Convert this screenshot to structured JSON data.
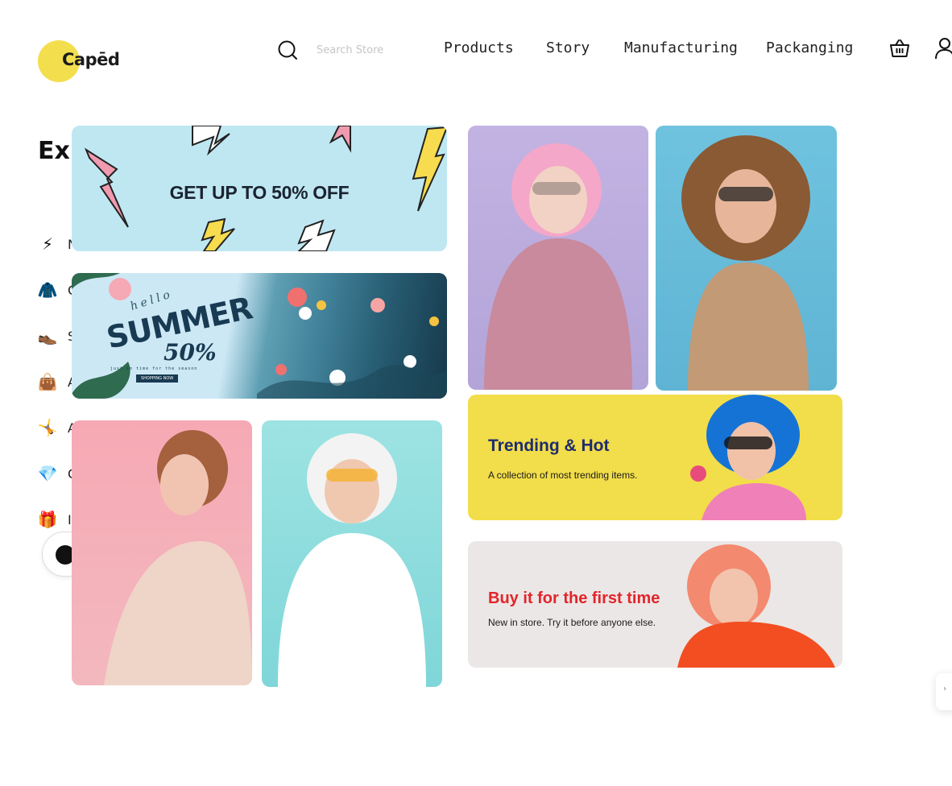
{
  "brand": {
    "name": "Capēd",
    "accent": "#f3de4e"
  },
  "search": {
    "placeholder": "Search Store"
  },
  "nav": {
    "items": [
      "Products",
      "Story",
      "Manufacturing",
      "Packanging"
    ]
  },
  "icons": {
    "search": "search-icon",
    "cart": "basket-icon",
    "user": "user-icon"
  },
  "sidebar": {
    "title": "Explore",
    "categories": [
      {
        "emoji": "⚡",
        "label": "N"
      },
      {
        "emoji": "🧥",
        "label": "C"
      },
      {
        "emoji": "👞",
        "label": "S"
      },
      {
        "emoji": "👜",
        "label": "A"
      },
      {
        "emoji": "🤸",
        "label": "A"
      },
      {
        "emoji": "💎",
        "label": "C"
      },
      {
        "emoji": "🎁",
        "label": "I"
      }
    ]
  },
  "mega_menu": {
    "sale_banner": {
      "text": "GET UP TO 50% OFF"
    },
    "summer_banner": {
      "hello": "hello",
      "title": "SUMMER",
      "discount": "50%",
      "tagline": "just in time for the season",
      "cta": "SHOPPING NOW"
    },
    "trending": {
      "title": "Trending & Hot",
      "subtitle": "A collection of most trending items.",
      "color": "#f2dd4a"
    },
    "first_time": {
      "title": "Buy it for the first time",
      "subtitle": "New in store. Try it before anyone else.",
      "title_color": "#e3242b"
    }
  }
}
